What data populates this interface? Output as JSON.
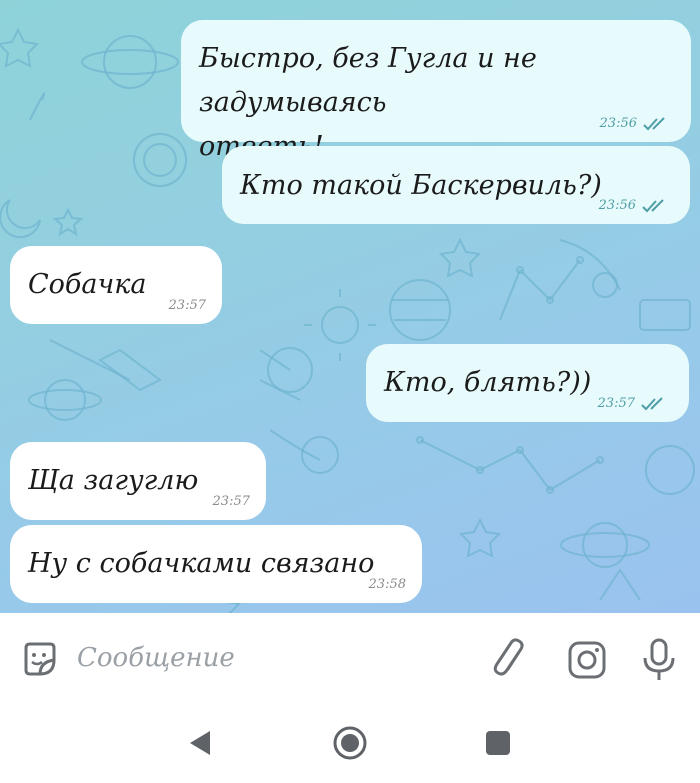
{
  "messages": [
    {
      "text": "Быстро, без Гугла и не задумываясь\nответь!",
      "time": "23:56",
      "direction": "out",
      "read": true
    },
    {
      "text": "Кто такой Баскервиль?)",
      "time": "23:56",
      "direction": "out",
      "read": true
    },
    {
      "text": "Собачка",
      "time": "23:57",
      "direction": "in"
    },
    {
      "text": "Кто, блять?))",
      "time": "23:57",
      "direction": "out",
      "read": true
    },
    {
      "text": "Ща загуглю",
      "time": "23:57",
      "direction": "in"
    },
    {
      "text": "Ну с собачками связано",
      "time": "23:58",
      "direction": "in"
    }
  ],
  "composer": {
    "placeholder": "Сообщение",
    "left_icon": "sticker-icon",
    "right_icons": [
      "paperclip-icon",
      "camera-icon",
      "microphone-icon"
    ]
  },
  "navigation": {
    "icons": [
      "back-icon",
      "home-icon",
      "recents-icon"
    ]
  },
  "colors": {
    "outgoing_bubble": "#e8fbfc",
    "incoming_bubble": "#ffffff",
    "check_color": "#4f9da6",
    "background_start": "#8fd3d9",
    "background_end": "#9ac2ee"
  }
}
